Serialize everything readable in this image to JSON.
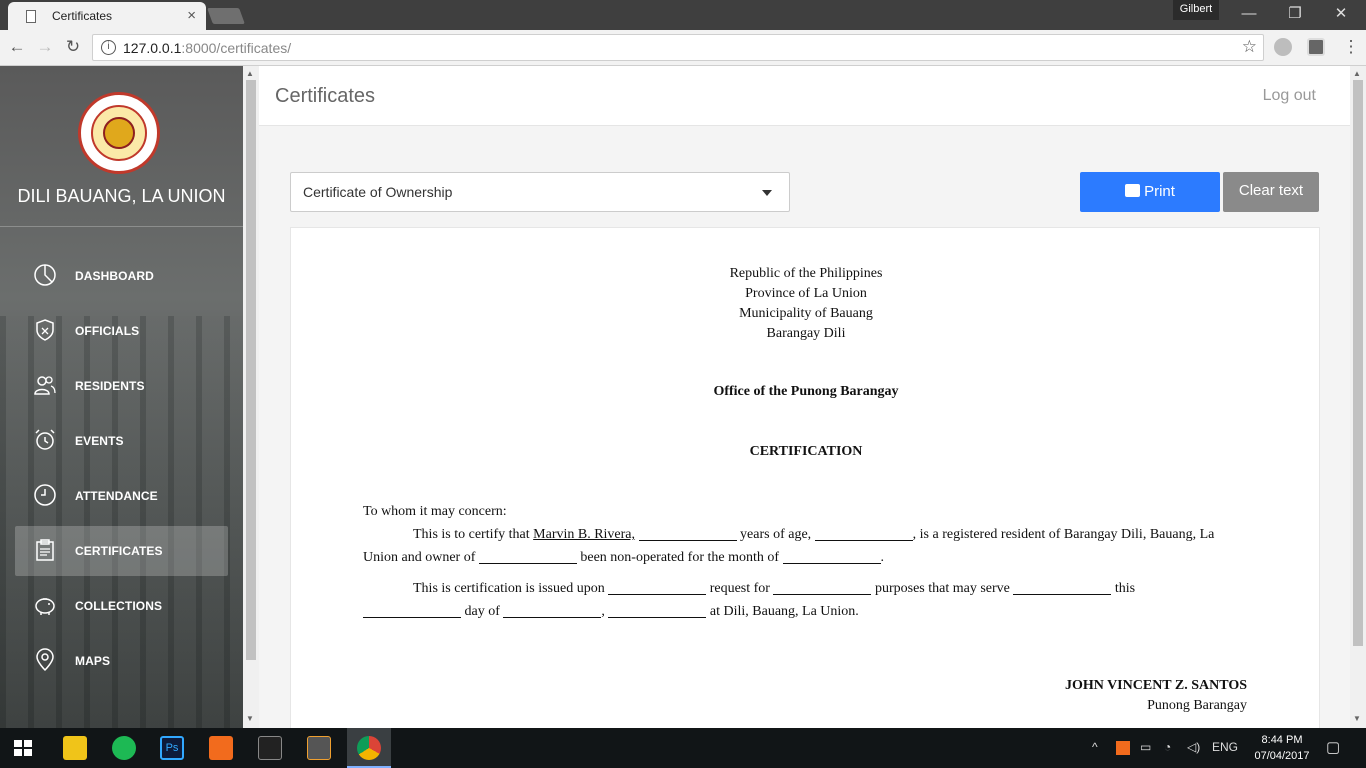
{
  "browser": {
    "tab_title": "Certificates",
    "tab_close": "×",
    "profile_name": "Gilbert",
    "url_host": "127.0.0.1",
    "url_rest": ":8000/certificates/",
    "window_buttons": {
      "minimize": "—",
      "restore": "❐",
      "close": "✕"
    }
  },
  "sidebar": {
    "brand": "DILI BAUANG, LA UNION",
    "items": [
      {
        "label": "DASHBOARD",
        "icon": "dashboard-icon"
      },
      {
        "label": "OFFICIALS",
        "icon": "shield-icon"
      },
      {
        "label": "RESIDENTS",
        "icon": "users-icon"
      },
      {
        "label": "EVENTS",
        "icon": "alarm-clock-icon"
      },
      {
        "label": "ATTENDANCE",
        "icon": "clock-icon"
      },
      {
        "label": "CERTIFICATES",
        "icon": "clipboard-icon",
        "active": true
      },
      {
        "label": "COLLECTIONS",
        "icon": "piggy-bank-icon"
      },
      {
        "label": "MAPS",
        "icon": "map-pin-icon"
      }
    ]
  },
  "header": {
    "title": "Certificates",
    "logout": "Log out"
  },
  "controls": {
    "certificate_type": "Certificate of Ownership",
    "print_label": "Print",
    "clear_label": "Clear text"
  },
  "document": {
    "heading_lines": [
      "Republic of the Philippines",
      "Province of La Union",
      "Municipality of Bauang",
      "Barangay Dili"
    ],
    "office": "Office of the Punong Barangay",
    "title": "CERTIFICATION",
    "salutation": "To whom it may concern:",
    "p1_a": "This is to certify that",
    "p1_name": "Marvin B. Rivera,",
    "p1_b": "years of age,",
    "p1_c": ", is a registered resident of Barangay Dili, Bauang, La",
    "p1_d": "Union and owner of",
    "p1_e": "been non-operated for the month of",
    "p1_f": ".",
    "p2_a": "This is certification is issued upon",
    "p2_b": "request for",
    "p2_c": "purposes that may serve",
    "p2_d": "this",
    "p2_e": "day of",
    "p2_f": ",",
    "p2_g": "at Dili, Bauang, La Union.",
    "signatory": "JOHN VINCENT Z. SANTOS",
    "position": "Punong Barangay"
  },
  "taskbar": {
    "lang": "ENG",
    "time": "8:44 PM",
    "date": "07/04/2017"
  },
  "colors": {
    "accent": "#2c7bff",
    "clear_button": "#8a8a8a",
    "seal_red": "#c0392b"
  }
}
